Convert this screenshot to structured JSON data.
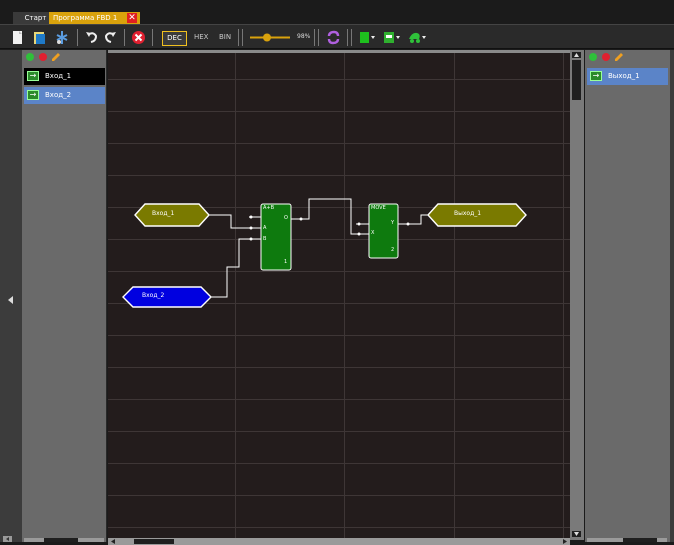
{
  "tabs": [
    {
      "label": "Старт"
    },
    {
      "label": "Программа FBD 1"
    }
  ],
  "toolbar": {
    "dec_label": "DEC",
    "hex_label": "HEX",
    "bin_label": "BIN",
    "zoom_label": "98%"
  },
  "left_panel": {
    "items": [
      {
        "label": "Вход_1"
      },
      {
        "label": "Вход_2"
      }
    ]
  },
  "right_panel": {
    "items": [
      {
        "label": "Выход_1"
      }
    ]
  },
  "diagram": {
    "inputs": [
      {
        "label": "Вход_1"
      },
      {
        "label": "Вход_2"
      }
    ],
    "outputs": [
      {
        "label": "Выход_1"
      }
    ],
    "blocks": [
      {
        "title": "A+B",
        "port_out": "O",
        "port_a": "A",
        "port_b": "B",
        "index": "1"
      },
      {
        "title": "MOVE",
        "port_x": "X",
        "port_y": "Y",
        "index": "2"
      }
    ]
  },
  "colors": {
    "accent": "#d9a20c",
    "input_var": "#7a7a00",
    "input_var_selected": "#0000e0",
    "output_var": "#7a7a00",
    "block": "#0e7a0e",
    "list_selected": "#5b84c8"
  }
}
